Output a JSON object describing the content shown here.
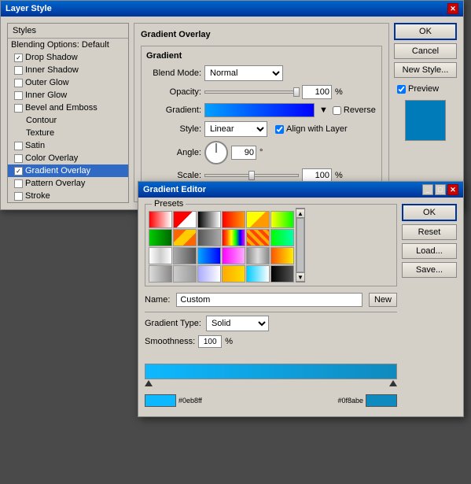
{
  "layerStyleWindow": {
    "title": "Layer Style",
    "sidebar": {
      "header": "Styles",
      "items": [
        {
          "id": "blending-options",
          "label": "Blending Options: Default",
          "checked": false,
          "active": false,
          "isHeader": true
        },
        {
          "id": "drop-shadow",
          "label": "Drop Shadow",
          "checked": true,
          "active": false
        },
        {
          "id": "inner-shadow",
          "label": "Inner Shadow",
          "checked": false,
          "active": false
        },
        {
          "id": "outer-glow",
          "label": "Outer Glow",
          "checked": false,
          "active": false
        },
        {
          "id": "inner-glow",
          "label": "Inner Glow",
          "checked": false,
          "active": false
        },
        {
          "id": "bevel-emboss",
          "label": "Bevel and Emboss",
          "checked": false,
          "active": false
        },
        {
          "id": "contour",
          "label": "Contour",
          "checked": false,
          "active": false,
          "indent": true
        },
        {
          "id": "texture",
          "label": "Texture",
          "checked": false,
          "active": false,
          "indent": true
        },
        {
          "id": "satin",
          "label": "Satin",
          "checked": false,
          "active": false
        },
        {
          "id": "color-overlay",
          "label": "Color Overlay",
          "checked": false,
          "active": false
        },
        {
          "id": "gradient-overlay",
          "label": "Gradient Overlay",
          "checked": true,
          "active": true
        },
        {
          "id": "pattern-overlay",
          "label": "Pattern Overlay",
          "checked": false,
          "active": false
        },
        {
          "id": "stroke",
          "label": "Stroke",
          "checked": false,
          "active": false
        }
      ]
    },
    "panel": {
      "title": "Gradient Overlay",
      "blendMode": {
        "label": "Blend Mode:",
        "value": "Normal"
      },
      "opacity": {
        "label": "Opacity:",
        "value": "100",
        "unit": "%"
      },
      "gradient": {
        "label": "Gradient:",
        "reverseLabel": "Reverse"
      },
      "style": {
        "label": "Style:",
        "value": "Linear",
        "alignLabel": "Align with Layer"
      },
      "angle": {
        "label": "Angle:",
        "value": "90",
        "unit": "°"
      },
      "scale": {
        "label": "Scale:",
        "value": "100",
        "unit": "%"
      }
    },
    "buttons": {
      "ok": "OK",
      "cancel": "Cancel",
      "newStyle": "New Style...",
      "preview": "Preview"
    }
  },
  "gradientEditor": {
    "title": "Gradient Editor",
    "presetsLabel": "Presets",
    "presets": [
      {
        "color1": "#ff0000",
        "color2": "#ffffff",
        "id": 0
      },
      {
        "color1": "#ff0000",
        "color2": "#00ff00",
        "id": 1
      },
      {
        "color1": "#000000",
        "color2": "#ffffff",
        "id": 2
      },
      {
        "color1": "#ff0000",
        "color2": "#ff9900",
        "id": 3
      },
      {
        "color1": "#ffff00",
        "color2": "#ff9900",
        "id": 4
      },
      {
        "color1": "#ffff00",
        "color2": "#00ff00",
        "id": 5
      },
      {
        "color1": "#00ff00",
        "color2": "#ffffff",
        "id": 6
      },
      {
        "color1": "#ff6600",
        "color2": "#ffcc00",
        "id": 7
      },
      {
        "color1": "#333333",
        "color2": "#999999",
        "id": 8
      },
      {
        "color1": "#ff0000",
        "color2": "#ff6600",
        "id": 9
      },
      {
        "color1": "#ff4400",
        "color2": "#ffaa00",
        "id": 10
      },
      {
        "color1": "#00ff00",
        "color2": "#00ffaa",
        "id": 11
      },
      {
        "color1": "#ffffff",
        "color2": "#cccccc",
        "id": 12
      },
      {
        "color1": "#aaaaaa",
        "color2": "#555555",
        "id": 13
      },
      {
        "color1": "#00aaff",
        "color2": "#0000ff",
        "id": 14
      },
      {
        "color1": "#ff00ff",
        "color2": "#ffaaff",
        "id": 15
      },
      {
        "color1": "#888888",
        "color2": "#dddddd",
        "id": 16
      },
      {
        "color1": "#ff5500",
        "color2": "#ffee00",
        "id": 17
      },
      {
        "color1": "#dddddd",
        "color2": "#888888",
        "id": 18
      },
      {
        "color1": "#cccccc",
        "color2": "#999999",
        "id": 19
      },
      {
        "color1": "#aaaaff",
        "color2": "#ffffff",
        "id": 20
      },
      {
        "color1": "#ffaa00",
        "color2": "#ffdd00",
        "id": 21
      },
      {
        "color1": "#00ccff",
        "color2": "#ffffff",
        "id": 22
      },
      {
        "color1": "#000000",
        "color2": "#555555",
        "id": 23
      }
    ],
    "nameLabel": "Name:",
    "nameValue": "Custom",
    "newButton": "New",
    "gradientTypeLabel": "Gradient Type:",
    "gradientTypeValue": "Solid",
    "smoothnessLabel": "Smoothness:",
    "smoothnessValue": "100",
    "smoothnessUnit": "%",
    "gradientBarColor1": "#0eb8ff",
    "gradientBarColor2": "#0f8abe",
    "stopLeft": "#0eb8ff",
    "stopRight": "#0f8abe",
    "stopLeftLabel": "#0eb8ff",
    "stopRightLabel": "#0f8abe",
    "buttons": {
      "ok": "OK",
      "reset": "Reset",
      "load": "Load...",
      "save": "Save..."
    }
  }
}
